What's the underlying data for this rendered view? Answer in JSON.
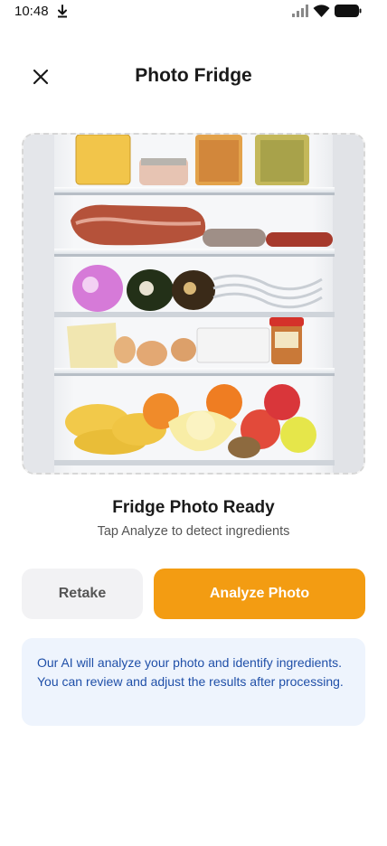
{
  "status_bar": {
    "time": "10:48",
    "icons": [
      "download-icon",
      "signal-icon",
      "wifi-icon",
      "battery-icon"
    ]
  },
  "header": {
    "title": "Photo Fridge",
    "close_icon": "close-icon"
  },
  "photo": {
    "description_icon": "fridge-photo",
    "shelf_count": 4
  },
  "status": {
    "title": "Fridge Photo Ready",
    "subtitle": "Tap Analyze to detect ingredients"
  },
  "actions": {
    "retake_label": "Retake",
    "analyze_label": "Analyze Photo"
  },
  "info": {
    "text": "Our AI will analyze your photo and identify ingredients. You can review and adjust the results after processing."
  },
  "colors": {
    "accent": "#f39c12",
    "info_bg": "#eef4fd",
    "info_text": "#1f4fa8",
    "secondary_button_bg": "#f2f2f4"
  }
}
